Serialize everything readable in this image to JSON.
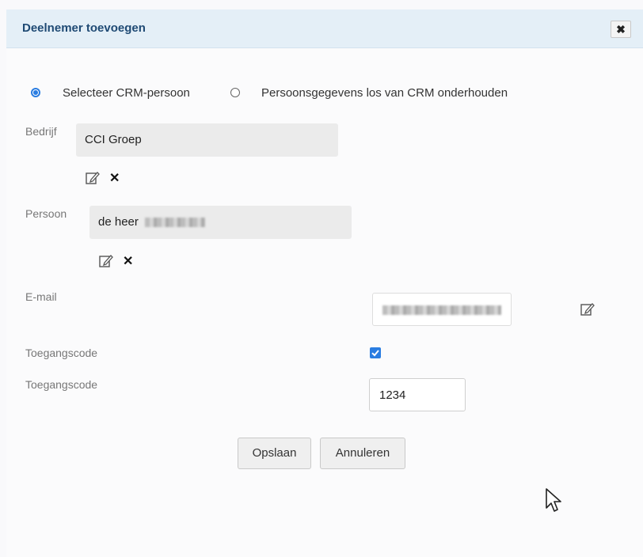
{
  "dialog": {
    "title": "Deelnemer toevoegen",
    "close_label": "✖"
  },
  "mode": {
    "option1": "Selecteer CRM-persoon",
    "option2": "Persoonsgegevens los van CRM onderhouden",
    "selected": "option1"
  },
  "company": {
    "label": "Bedrijf",
    "value": "CCI Groep"
  },
  "person": {
    "label": "Persoon",
    "value_prefix": "de heer"
  },
  "email": {
    "label": "E-mail"
  },
  "access_code_toggle": {
    "label": "Toegangscode",
    "checked": true
  },
  "access_code": {
    "label": "Toegangscode",
    "value": "1234"
  },
  "actions": {
    "save": "Opslaan",
    "cancel": "Annuleren"
  },
  "icons": {
    "edit": "pencil-square-icon",
    "remove": "close-icon",
    "cursor": "mouse-pointer-icon"
  },
  "colors": {
    "accent": "#2a7de1",
    "titlebar_bg": "#e4eff7",
    "title_text": "#1f4a74"
  }
}
